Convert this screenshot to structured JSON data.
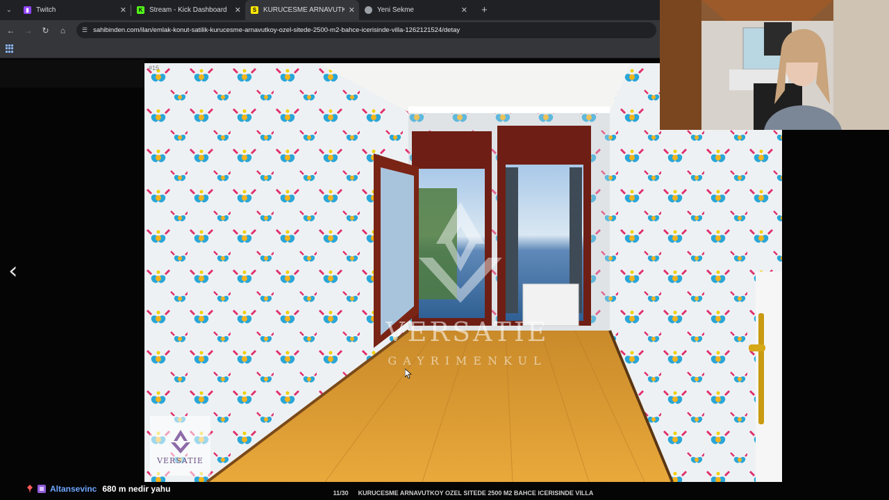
{
  "browser": {
    "tabs": [
      {
        "label": "Twitch",
        "favicon": "twitch-icon",
        "color": "#9146ff",
        "active": false
      },
      {
        "label": "Stream - Kick Dashboard",
        "favicon": "kick-icon",
        "color": "#53fc18",
        "active": false
      },
      {
        "label": "KURUCESME ARNAVUTKOY OZ",
        "favicon": "sahibinden-icon",
        "color": "#ffe800",
        "active": true
      },
      {
        "label": "Yeni Sekme",
        "favicon": "chrome-icon",
        "color": "#9aa0a6",
        "active": false
      }
    ],
    "url": "sahibinden.com/ilan/emlak-konut-satilik-kurucesme-arnavutkoy-ozel-sitede-2500-m2-bahce-icerisinde-villa-1262121524/detay"
  },
  "listing": {
    "photo_index_mark": "#15",
    "watermark_brand": "VERSATIE",
    "watermark_sub": "GAYRIMENKUL",
    "logo_text": "VERSATIE",
    "photo_counter": "11/30",
    "caption": "KURUCESME ARNAVUTKOY OZEL SITEDE 2500 M2 BAHCE ICERISINDE VILLA"
  },
  "chat": {
    "username": "Altansevinc",
    "message": "680 m nedir yahu",
    "user_color": "#6ea7ff"
  }
}
